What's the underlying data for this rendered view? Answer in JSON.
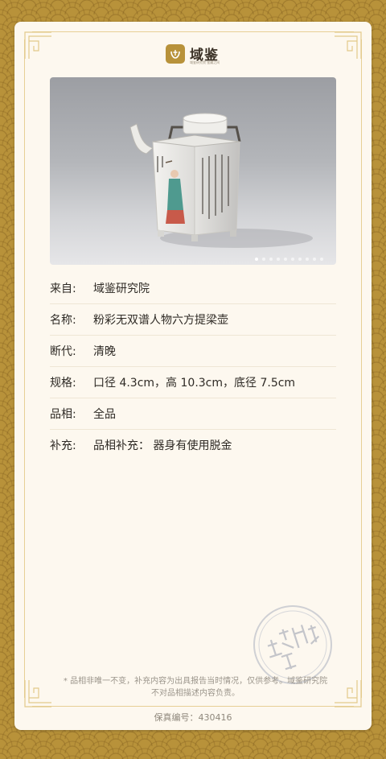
{
  "brand": {
    "name": "域鉴",
    "tagline": "域鉴研究院 鉴藏之间"
  },
  "photo": {
    "alt": "粉彩无双谱人物六方提梁壶",
    "slides": 10,
    "active_index": 0
  },
  "details": [
    {
      "label": "来自:",
      "value": "域鉴研究院"
    },
    {
      "label": "名称:",
      "value": "粉彩无双谱人物六方提梁壶"
    },
    {
      "label": "断代:",
      "value": "清晚"
    },
    {
      "label": "规格:",
      "value": "口径 4.3cm，高 10.3cm，底径 7.5cm"
    },
    {
      "label": "品相:",
      "value": "全品"
    },
    {
      "label": "补充:",
      "value": "品相补充：  器身有使用脱金"
    }
  ],
  "stamp": {
    "text": "域鉴研究院"
  },
  "disclaimer": "* 品相非唯一不变，补充内容为出具报告当时情况，仅供参考。域鉴研究院不对品相描述内容负责。",
  "serial": {
    "label": "保真编号：",
    "value": "430416"
  },
  "colors": {
    "gold": "#b8923a",
    "card": "#fdf8ef",
    "frame": "#e7cf95"
  }
}
